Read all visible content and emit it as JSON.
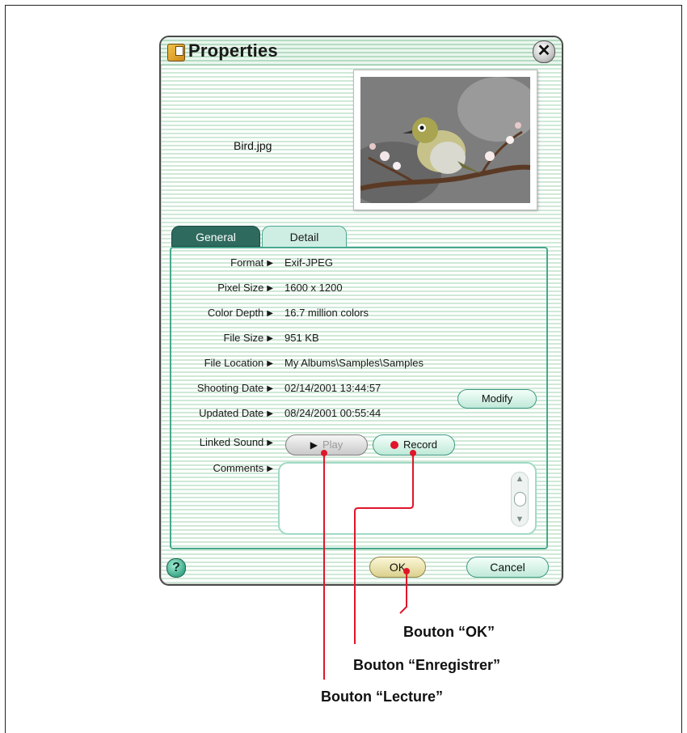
{
  "window": {
    "title": "Properties",
    "close_label": "✕",
    "filename": "Bird.jpg",
    "tabs": [
      {
        "label": "General",
        "active": true
      },
      {
        "label": "Detail",
        "active": false
      }
    ],
    "fields": [
      {
        "label": "Format",
        "value": "Exif-JPEG"
      },
      {
        "label": "Pixel Size",
        "value": "1600 x 1200"
      },
      {
        "label": "Color Depth",
        "value": "16.7 million colors"
      },
      {
        "label": "File Size",
        "value": "951 KB"
      },
      {
        "label": "File Location",
        "value": "My Albums\\Samples\\Samples"
      },
      {
        "label": "Shooting Date",
        "value": "02/14/2001 13:44:57"
      },
      {
        "label": "Updated Date",
        "value": "08/24/2001 00:55:44"
      },
      {
        "label": "Linked Sound",
        "value": ""
      },
      {
        "label": "Comments",
        "value": ""
      }
    ],
    "buttons": {
      "modify": "Modify",
      "play": "Play",
      "record": "Record",
      "ok": "OK",
      "cancel": "Cancel",
      "help": "?"
    }
  },
  "callouts": {
    "ok": "Bouton “OK”",
    "record": "Bouton “Enregistrer”",
    "play": "Bouton “Lecture”"
  },
  "colors": {
    "accent": "#48a88e",
    "callout_line": "#e0162a",
    "tab_active": "#2e6b5e"
  },
  "icons": {
    "title": "properties-app-icon",
    "close": "close-icon",
    "help": "help-icon",
    "play": "play-triangle-icon",
    "record": "record-dot-icon"
  }
}
